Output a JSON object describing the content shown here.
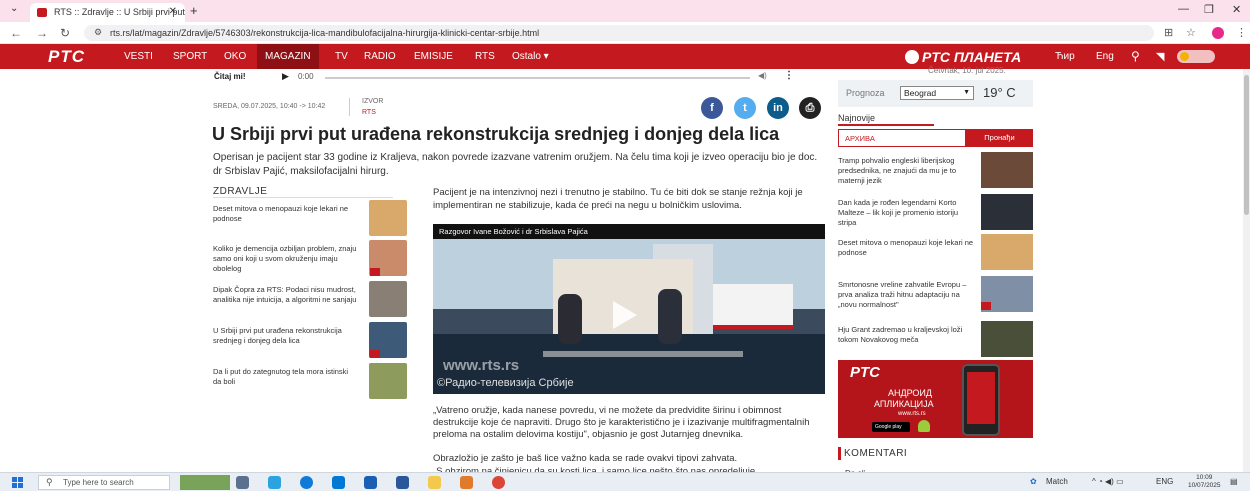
{
  "browser": {
    "tab_title": "RTS :: Zdravlje :: U Srbiji prvi put",
    "new_tab": "+",
    "url": "rts.rs/lat/magazin/Zdravlje/5746303/rekonstrukcija-lica-mandibulofacijalna-hirurgija-klinicki-centar-srbije.html"
  },
  "nav": {
    "logo": "PTC",
    "items": [
      "VESTI",
      "SPORT",
      "OKO",
      "MAGAZIN",
      "TV",
      "RADIO",
      "EMISIJE",
      "RTS",
      "Ostalo ▾"
    ],
    "active": "MAGAZIN",
    "planeta": "PTC ПЛАНЕТА",
    "script_cyr": "Ћир",
    "lang": "Eng"
  },
  "audio": {
    "label": "Čitaj mi!",
    "time": "0:00"
  },
  "meta": {
    "date": "SREDA, 09.07.2025, 10:40 -> 10:42",
    "izvor_label": "IZVOR",
    "izvor_value": "RTS"
  },
  "article": {
    "title": "U Srbiji prvi put urađena rekonstrukcija srednjeg i donjeg dela lica",
    "lead": "Operisan je pacijent star 33 godine iz Kraljeva, nakon povrede izazvane vatrenim oružjem. Na čelu tima koji je izveo operaciju bio je doc. dr Srbislav Pajić, maksilofacijalni hirurg.",
    "p1": "Pacijent je na intenzivnoj nezi i trenutno je stabilno. Tu će biti dok se stanje režnja koji je implementiran ne stabilizuje, kada će preći na negu u bolničkim uslovima.",
    "video_title": "Razgovor Ivane Božović i dr Srbislava Pajića",
    "video_wm1": "www.rts.rs",
    "video_wm2": "©Радио-телевизија Србије",
    "p2": "„Vatreno oružje, kada nanese povredu, vi ne možete da predvidite širinu i obimnost destrukcije koje će napraviti. Drugo što je karakteristično je i izazivanje multifragmentalnih preloma na ostalim delovima kostiju\", objasnio je gost Jutarnjeg dnevnika.",
    "p3": "Obrazložio je zašto je baš lice važno kada se rade ovakvi tipovi zahvata.",
    "p4": "„S obzirom na činjenicu da su kosti lica, i samo lice nešto što nas opredeljuje"
  },
  "related": {
    "heading": "ZDRAVLJE",
    "items": [
      {
        "title": "Deset mitova o menopauzi koje lekari ne podnose",
        "color": "#d9a86b"
      },
      {
        "title": "Koliko je demencija ozbiljan problem, znaju samo oni koji u svom okruženju imaju obolelog",
        "color": "#c98b6a"
      },
      {
        "title": "Dipak Čopra za RTS: Podaci nisu mudrost, analitika nije intuicija, a algoritmi ne sanjaju",
        "color": "#8a7f74"
      },
      {
        "title": "U Srbiji prvi put urađena rekonstrukcija srednjeg i donjeg dela lica",
        "color": "#3d5a78"
      },
      {
        "title": "Da li put do zategnutog tela mora istinski da boli",
        "color": "#8d9b5c"
      }
    ]
  },
  "sidebar": {
    "date": "Četvrtak, 10. jul 2025.",
    "weather_label": "Prognoza",
    "city": "Beograd",
    "temp": "19° C",
    "najnovije": "Najnovije",
    "archive_placeholder": "АРХИВА",
    "search_btn": "Пронађи",
    "news": [
      {
        "title": "Tramp pohvalio engleski liberijskog predsednika, ne znajući da mu je to maternji jezik",
        "color": "#6b4a3a"
      },
      {
        "title": "Dan kada je rođen legendarni Korto Malteze – lik koji je promenio istoriju stripa",
        "color": "#2a2f38"
      },
      {
        "title": "Deset mitova o menopauzi koje lekari ne podnose",
        "color": "#d9a86b"
      },
      {
        "title": "Smrtonosne vreline zahvatile Evropu – prva analiza traži hitnu adaptaciju na „novu normalnost\"",
        "color": "#7f8fa6"
      },
      {
        "title": "Hju Grant zadremao u kraljevskoj loži tokom Novakovog meča",
        "color": "#4a4f3a"
      }
    ],
    "ad": {
      "logo": "PTC",
      "line1": "АНДРОИД",
      "line2": "АПЛИКАЦИЈА",
      "line3": "www.rts.rs",
      "gp": "Google play"
    },
    "komentari": "KOMENTARI",
    "daali": "Da ali"
  },
  "taskbar": {
    "search": "Type here to search",
    "weather": "Match",
    "lang": "ENG",
    "time": "10:09",
    "date": "10/07/2025"
  }
}
